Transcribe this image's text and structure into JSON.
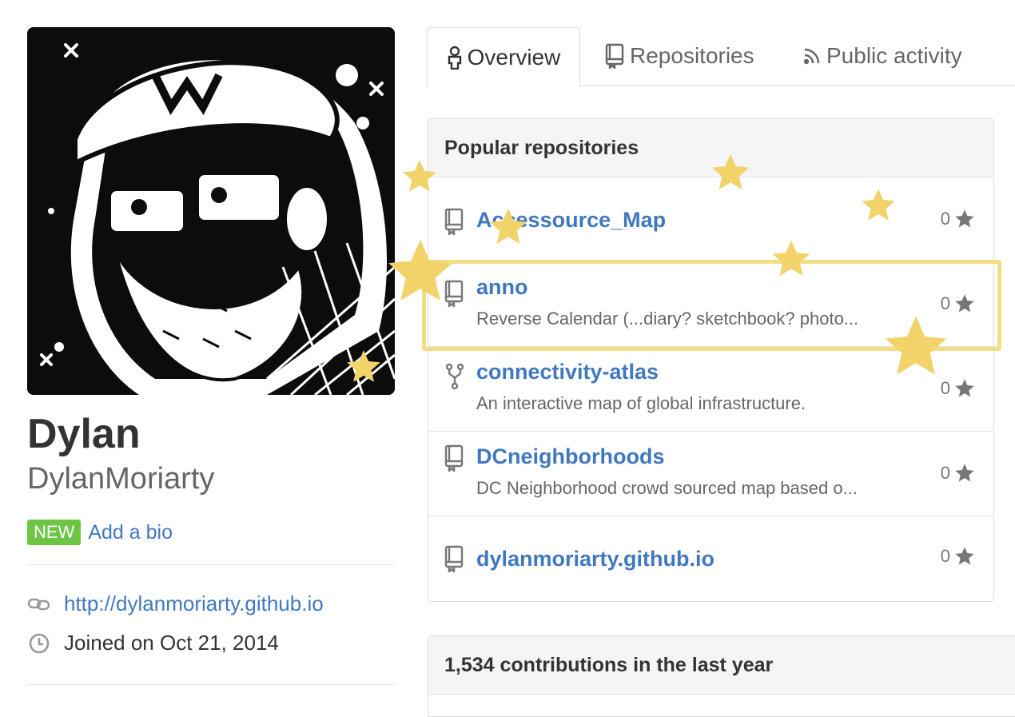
{
  "profile": {
    "name": "Dylan",
    "login": "DylanMoriarty",
    "bio_badge": "NEW",
    "bio_link": "Add a bio",
    "website": "http://dylanmoriarty.github.io",
    "joined": "Joined on Oct 21, 2014"
  },
  "tabs": [
    {
      "label": "Overview",
      "icon": "person-icon",
      "selected": true
    },
    {
      "label": "Repositories",
      "icon": "repo-icon",
      "selected": false
    },
    {
      "label": "Public activity",
      "icon": "rss-icon",
      "selected": false
    }
  ],
  "popular": {
    "title": "Popular repositories",
    "repos": [
      {
        "name": "Accessource_Map",
        "description": "",
        "stars": "0",
        "icon": "repo-icon"
      },
      {
        "name": "anno",
        "description": "Reverse Calendar (...diary? sketchbook? photo...",
        "stars": "0",
        "icon": "repo-icon"
      },
      {
        "name": "connectivity-atlas",
        "description": "An interactive map of global infrastructure.",
        "stars": "0",
        "icon": "fork-icon"
      },
      {
        "name": "DCneighborhoods",
        "description": "DC Neighborhood crowd sourced map based o...",
        "stars": "0",
        "icon": "repo-icon"
      },
      {
        "name": "dylanmoriarty.github.io",
        "description": "",
        "stars": "0",
        "icon": "repo-icon"
      }
    ]
  },
  "contributions": {
    "title": "1,534 contributions in the last year"
  },
  "colors": {
    "link": "#4078c0",
    "badge": "#6cc644",
    "highlight": "#f3dd85",
    "star_decoration": "#f1d36a"
  }
}
